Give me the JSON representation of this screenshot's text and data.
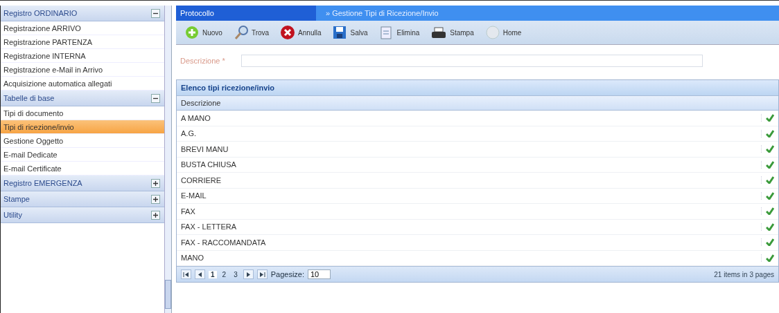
{
  "sidebar": {
    "sections": [
      {
        "title": "Registro ORDINARIO",
        "expanded": true,
        "items": [
          {
            "label": "Registrazione ARRIVO",
            "selected": false
          },
          {
            "label": "Registrazione PARTENZA",
            "selected": false
          },
          {
            "label": "Registrazione INTERNA",
            "selected": false
          },
          {
            "label": "Registrazione e-Mail in Arrivo",
            "selected": false
          },
          {
            "label": "Acquisizione automatica allegati",
            "selected": false
          }
        ]
      },
      {
        "title": "Tabelle di base",
        "expanded": true,
        "items": [
          {
            "label": "Tipi di documento",
            "selected": false
          },
          {
            "label": "Tipi di ricezione/invio",
            "selected": true
          },
          {
            "label": "Gestione Oggetto",
            "selected": false
          },
          {
            "label": "E-mail Dedicate",
            "selected": false
          },
          {
            "label": "E-mail Certificate",
            "selected": false
          }
        ]
      },
      {
        "title": "Registro EMERGENZA",
        "expanded": false
      },
      {
        "title": "Stampe",
        "expanded": false
      },
      {
        "title": "Utility",
        "expanded": false
      }
    ]
  },
  "header": {
    "tab": "Protocollo",
    "breadcrumb": "» Gestione Tipi di Ricezione/Invio"
  },
  "toolbar": [
    {
      "kind": "new",
      "label": "Nuovo"
    },
    {
      "kind": "find",
      "label": "Trova"
    },
    {
      "kind": "cancel",
      "label": "Annulla"
    },
    {
      "kind": "save",
      "label": "Salva"
    },
    {
      "kind": "delete",
      "label": "Elimina"
    },
    {
      "kind": "print",
      "label": "Stampa"
    },
    {
      "kind": "home",
      "label": "Home"
    }
  ],
  "form": {
    "label": "Descrizione *"
  },
  "grid": {
    "title": "Elenco tipi ricezione/invio",
    "columns": [
      "Descrizione"
    ],
    "rows": [
      {
        "text": "A MANO",
        "checked": true
      },
      {
        "text": "A.G.",
        "checked": true
      },
      {
        "text": "BREVI MANU",
        "checked": true
      },
      {
        "text": "BUSTA CHIUSA",
        "checked": true
      },
      {
        "text": "CORRIERE",
        "checked": true
      },
      {
        "text": "E-MAIL",
        "checked": true
      },
      {
        "text": "FAX",
        "checked": true
      },
      {
        "text": "FAX - LETTERA",
        "checked": true
      },
      {
        "text": "FAX - RACCOMANDATA",
        "checked": true
      },
      {
        "text": "MANO",
        "checked": true
      }
    ],
    "pager": {
      "pages": [
        {
          "label": "1",
          "selected": true
        },
        {
          "label": "2",
          "selected": false
        },
        {
          "label": "3",
          "selected": false
        }
      ],
      "pagesize_label": "Pagesize:",
      "pagesize": "10",
      "summary": "21 items in 3 pages"
    }
  }
}
